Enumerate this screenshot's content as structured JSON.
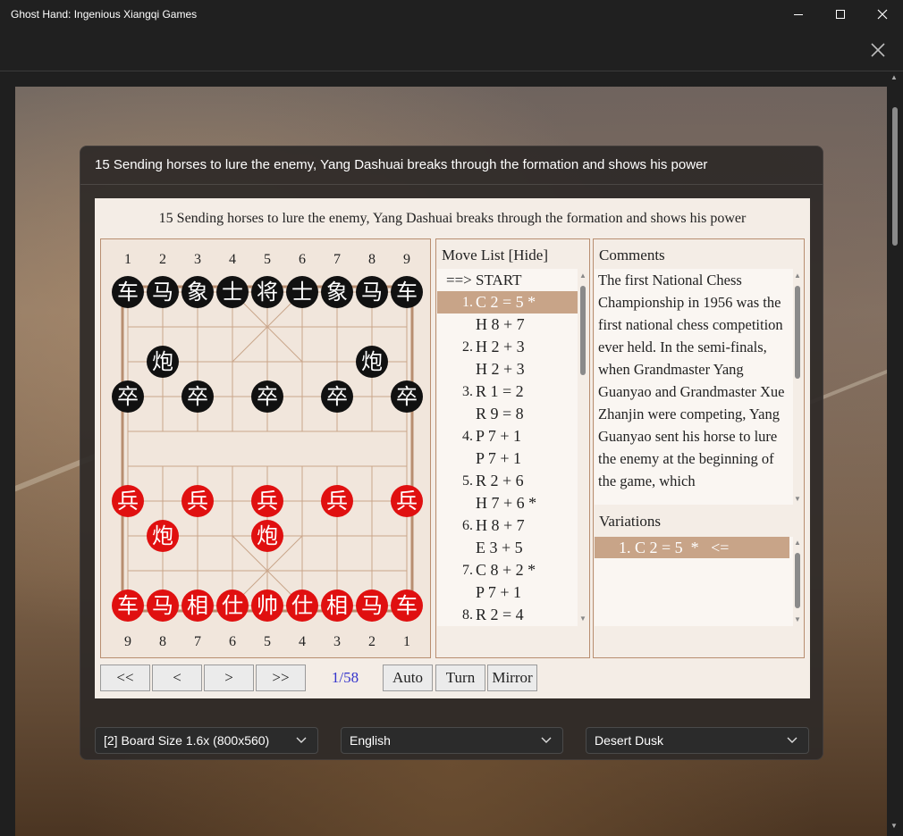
{
  "window": {
    "title": "Ghost Hand: Ingenious Xiangqi Games"
  },
  "dialog": {
    "title": "15 Sending horses to lure the enemy, Yang Dashuai breaks through the formation and shows his power"
  },
  "panel": {
    "title": "15 Sending horses to lure the enemy, Yang Dashuai breaks through the formation and shows his power"
  },
  "board": {
    "top_coords": [
      "1",
      "2",
      "3",
      "4",
      "5",
      "6",
      "7",
      "8",
      "9"
    ],
    "bottom_coords": [
      "9",
      "8",
      "7",
      "6",
      "5",
      "4",
      "3",
      "2",
      "1"
    ],
    "pieces": [
      {
        "ch": "车",
        "side": "black",
        "col": 0,
        "row": 0
      },
      {
        "ch": "马",
        "side": "black",
        "col": 1,
        "row": 0
      },
      {
        "ch": "象",
        "side": "black",
        "col": 2,
        "row": 0
      },
      {
        "ch": "士",
        "side": "black",
        "col": 3,
        "row": 0
      },
      {
        "ch": "将",
        "side": "black",
        "col": 4,
        "row": 0
      },
      {
        "ch": "士",
        "side": "black",
        "col": 5,
        "row": 0
      },
      {
        "ch": "象",
        "side": "black",
        "col": 6,
        "row": 0
      },
      {
        "ch": "马",
        "side": "black",
        "col": 7,
        "row": 0
      },
      {
        "ch": "车",
        "side": "black",
        "col": 8,
        "row": 0
      },
      {
        "ch": "炮",
        "side": "black",
        "col": 1,
        "row": 2
      },
      {
        "ch": "炮",
        "side": "black",
        "col": 7,
        "row": 2
      },
      {
        "ch": "卒",
        "side": "black",
        "col": 0,
        "row": 3
      },
      {
        "ch": "卒",
        "side": "black",
        "col": 2,
        "row": 3
      },
      {
        "ch": "卒",
        "side": "black",
        "col": 4,
        "row": 3
      },
      {
        "ch": "卒",
        "side": "black",
        "col": 6,
        "row": 3
      },
      {
        "ch": "卒",
        "side": "black",
        "col": 8,
        "row": 3
      },
      {
        "ch": "兵",
        "side": "red",
        "col": 0,
        "row": 6
      },
      {
        "ch": "兵",
        "side": "red",
        "col": 2,
        "row": 6
      },
      {
        "ch": "兵",
        "side": "red",
        "col": 4,
        "row": 6
      },
      {
        "ch": "兵",
        "side": "red",
        "col": 6,
        "row": 6
      },
      {
        "ch": "兵",
        "side": "red",
        "col": 8,
        "row": 6
      },
      {
        "ch": "炮",
        "side": "red",
        "col": 1,
        "row": 7
      },
      {
        "ch": "炮",
        "side": "red",
        "col": 4,
        "row": 7
      },
      {
        "ch": "车",
        "side": "red",
        "col": 0,
        "row": 9
      },
      {
        "ch": "马",
        "side": "red",
        "col": 1,
        "row": 9
      },
      {
        "ch": "相",
        "side": "red",
        "col": 2,
        "row": 9
      },
      {
        "ch": "仕",
        "side": "red",
        "col": 3,
        "row": 9
      },
      {
        "ch": "帅",
        "side": "red",
        "col": 4,
        "row": 9
      },
      {
        "ch": "仕",
        "side": "red",
        "col": 5,
        "row": 9
      },
      {
        "ch": "相",
        "side": "red",
        "col": 6,
        "row": 9
      },
      {
        "ch": "马",
        "side": "red",
        "col": 7,
        "row": 9
      },
      {
        "ch": "车",
        "side": "red",
        "col": 8,
        "row": 9
      }
    ]
  },
  "movelist": {
    "header": "Move List [Hide]",
    "start": "==> START",
    "rows": [
      {
        "num": "1.",
        "move": "C 2 = 5 *",
        "selected": true
      },
      {
        "num": "",
        "move": "H 8 + 7",
        "selected": false
      },
      {
        "num": "2.",
        "move": "H 2 + 3",
        "selected": false
      },
      {
        "num": "",
        "move": "H 2 + 3",
        "selected": false
      },
      {
        "num": "3.",
        "move": "R 1 = 2",
        "selected": false
      },
      {
        "num": "",
        "move": "R 9 = 8",
        "selected": false
      },
      {
        "num": "4.",
        "move": "P 7 + 1",
        "selected": false
      },
      {
        "num": "",
        "move": "P 7 + 1",
        "selected": false
      },
      {
        "num": "5.",
        "move": "R 2 + 6",
        "selected": false
      },
      {
        "num": "",
        "move": "H 7 + 6 *",
        "selected": false
      },
      {
        "num": "6.",
        "move": "H 8 + 7",
        "selected": false
      },
      {
        "num": "",
        "move": "E 3 + 5",
        "selected": false
      },
      {
        "num": "7.",
        "move": "C 8 + 2 *",
        "selected": false
      },
      {
        "num": "",
        "move": "P 7 + 1",
        "selected": false
      },
      {
        "num": "8.",
        "move": "R 2 = 4",
        "selected": false
      }
    ]
  },
  "comments": {
    "header": "Comments",
    "text": "The first National Chess Championship in 1956 was the first national chess competition ever held. In the semi-finals, when Grandmaster Yang Guanyao and Grandmaster Xue Zhanjin were competing, Yang Guanyao sent his horse to lure the enemy at the beginning of the game, which",
    "variations_header": "Variations",
    "variation": "1. C 2 = 5  *   <="
  },
  "controls": {
    "first": "<<",
    "prev": "<",
    "next": ">",
    "last": ">>",
    "counter": "1/58",
    "auto": "Auto",
    "turn": "Turn",
    "mirror": "Mirror"
  },
  "dropdowns": {
    "board_size": "[2] Board Size 1.6x (800x560)",
    "language": "English",
    "theme": "Desert Dusk"
  }
}
